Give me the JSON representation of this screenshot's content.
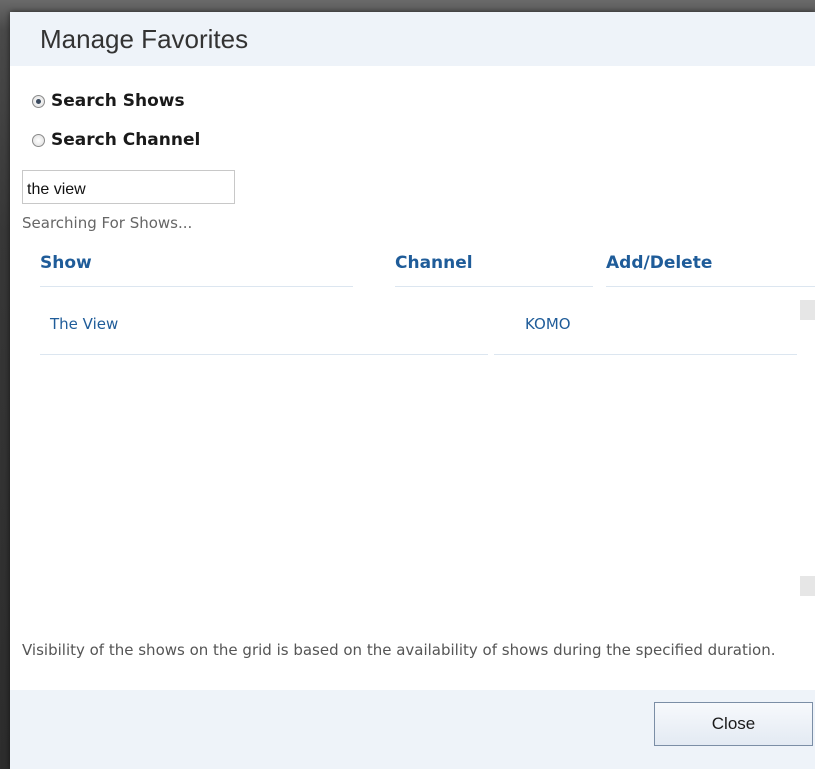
{
  "dialog": {
    "title": "Manage Favorites"
  },
  "search_mode": {
    "options": [
      {
        "label": "Search Shows",
        "checked": true
      },
      {
        "label": "Search Channel",
        "checked": false
      }
    ]
  },
  "search": {
    "value": "the view",
    "status": "Searching For Shows..."
  },
  "table": {
    "headers": [
      "Show",
      "Channel",
      "Add/Delete"
    ],
    "rows": [
      {
        "show": "The View",
        "channel": "KOMO"
      }
    ]
  },
  "footnote": "Visibility of the shows on the grid is based on the availability of shows during the specified duration.",
  "footer": {
    "close_label": "Close"
  },
  "colors": {
    "accent": "#1f5c99",
    "panel": "#eef3f9"
  }
}
